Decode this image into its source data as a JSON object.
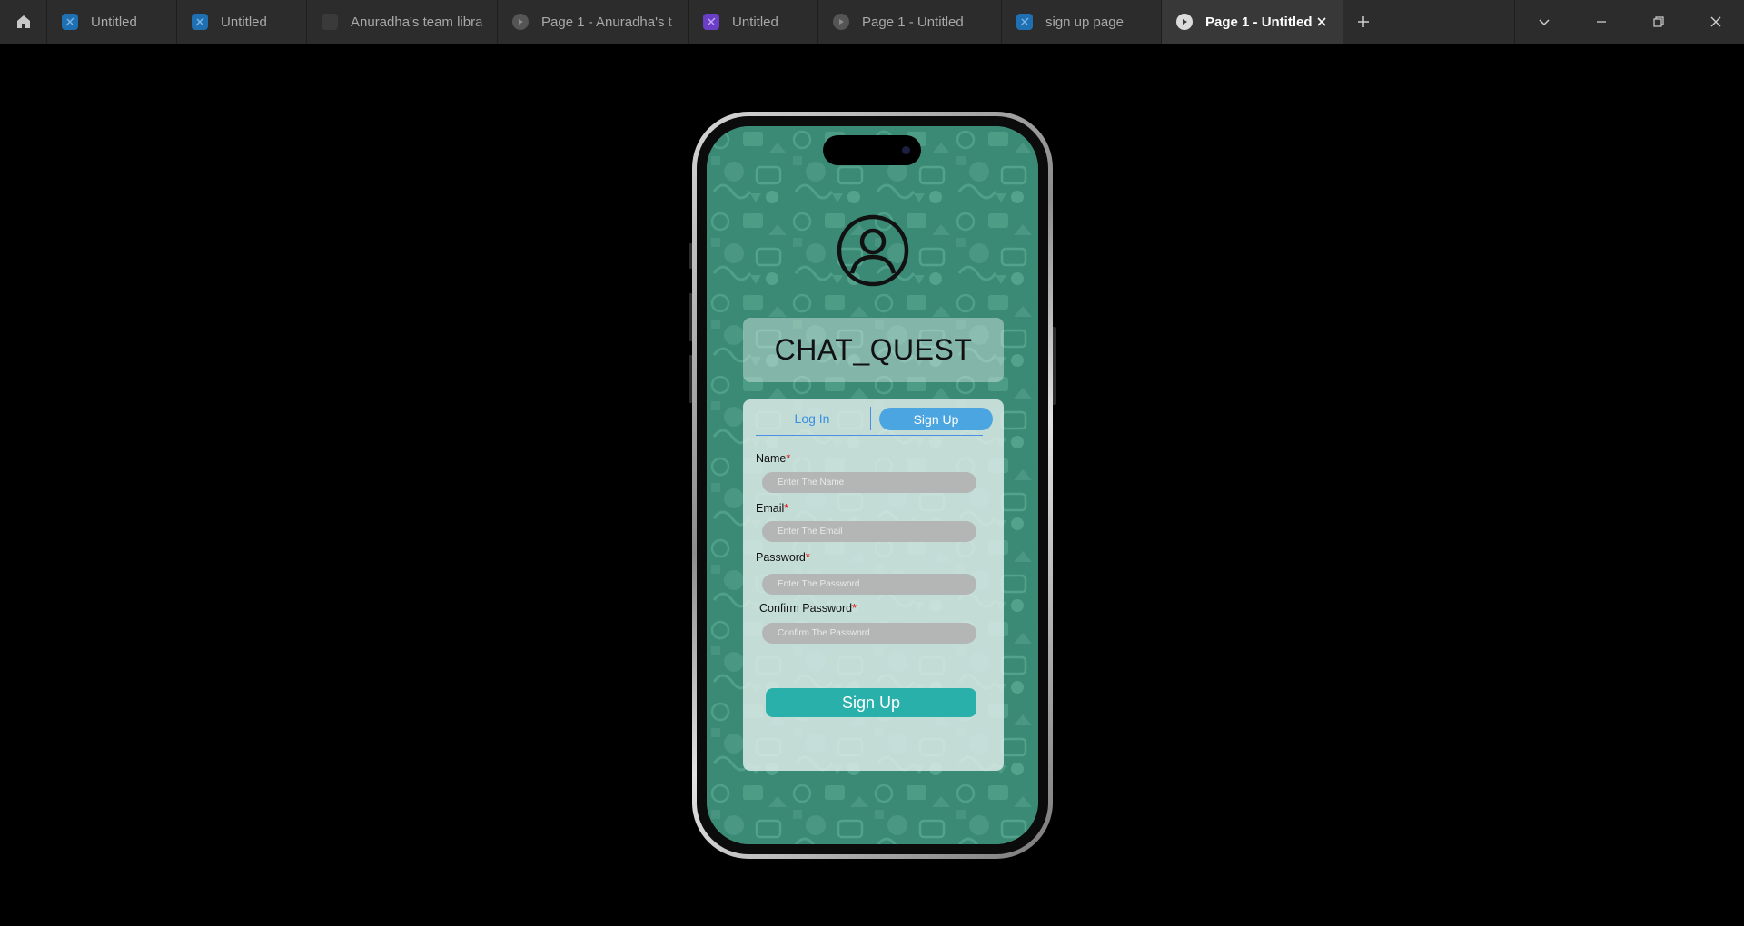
{
  "tabs": [
    {
      "label": "Untitled",
      "icon": "figjam-file-icon",
      "color": "#1f6fb3",
      "active": false
    },
    {
      "label": "Untitled",
      "icon": "figjam-file-icon",
      "color": "#1f6fb3",
      "active": false
    },
    {
      "label": "Anuradha's team libra",
      "icon": "team-library-icon",
      "color": "#3a3a3a",
      "active": false
    },
    {
      "label": "Page 1 - Anuradha's t",
      "icon": "prototype-play-icon",
      "color": "#5a5a5a",
      "active": false
    },
    {
      "label": "Untitled",
      "icon": "slides-file-icon",
      "color": "#6a3fc6",
      "active": false
    },
    {
      "label": "Page 1 - Untitled",
      "icon": "prototype-play-icon",
      "color": "#5a5a5a",
      "active": false
    },
    {
      "label": "sign up page",
      "icon": "figjam-file-icon",
      "color": "#1f6fb3",
      "active": false
    },
    {
      "label": "Page 1 - Untitled",
      "icon": "prototype-play-icon",
      "color": "#dcdcdc",
      "active": true
    }
  ],
  "app": {
    "title": "CHAT_QUEST",
    "auth_tabs": {
      "login": "Log In",
      "signup": "Sign Up",
      "selected": "Sign Up"
    },
    "fields": [
      {
        "label": "Name",
        "required": "*",
        "placeholder": "Enter The Name"
      },
      {
        "label": "Email",
        "required": "*",
        "placeholder": "Enter The Email"
      },
      {
        "label": "Password",
        "required": "*",
        "placeholder": "Enter The Password"
      },
      {
        "label": "Confirm Password",
        "required": "*",
        "placeholder": "Confirm The Password"
      }
    ],
    "submit_label": "Sign Up"
  },
  "colors": {
    "screen_background": "#3b8a75",
    "accent_blue": "#4ba5e0",
    "submit_teal": "#2ab0aa",
    "required_red": "#e00000"
  }
}
